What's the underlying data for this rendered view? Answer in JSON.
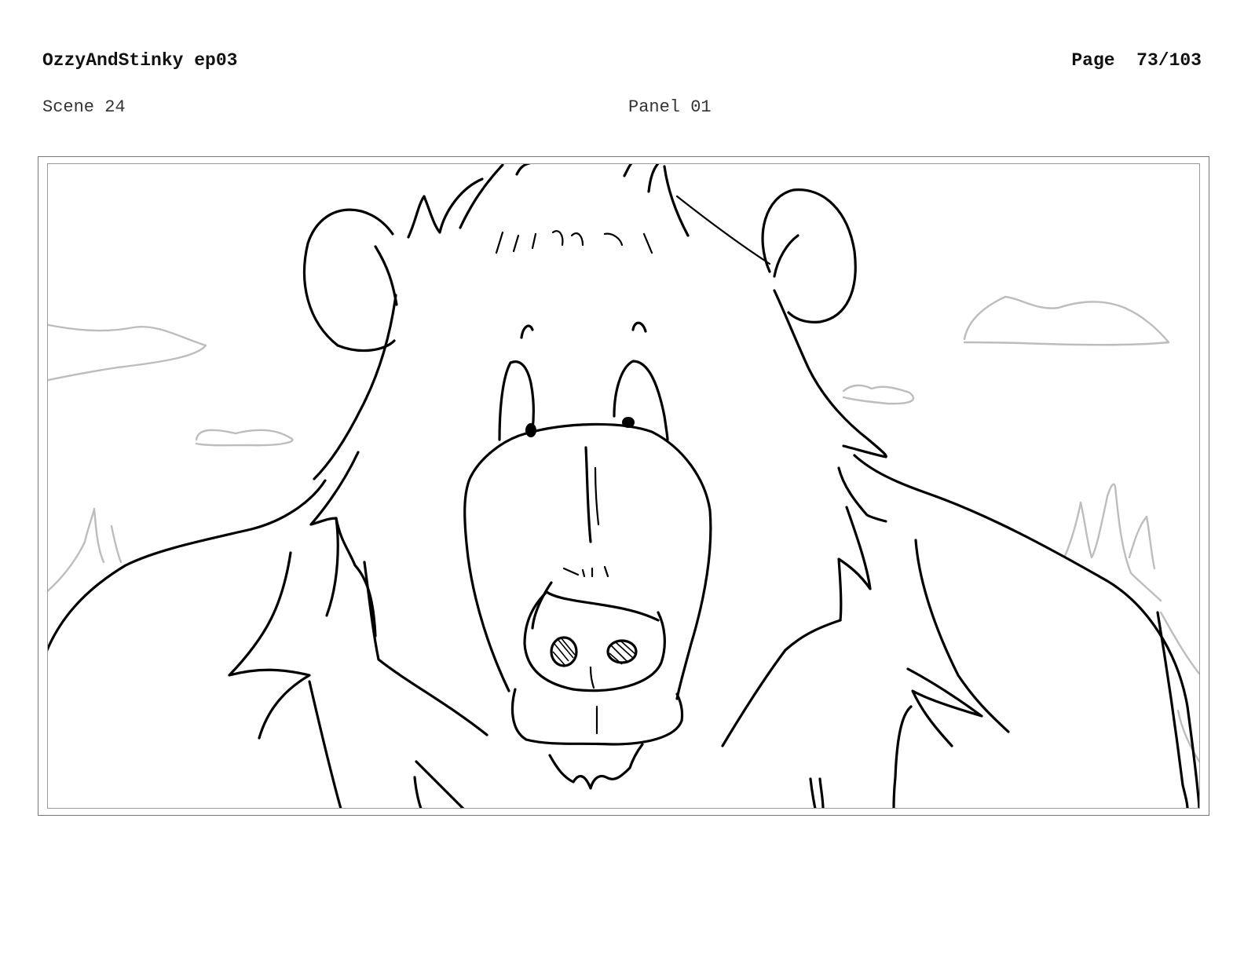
{
  "header": {
    "title": "OzzyAndStinky ep03",
    "page_label": "Page",
    "page_number": "73/103"
  },
  "meta": {
    "scene": "Scene 24",
    "panel": "Panel 01"
  },
  "panel_image": {
    "icon": "bear-sketch-icon"
  }
}
